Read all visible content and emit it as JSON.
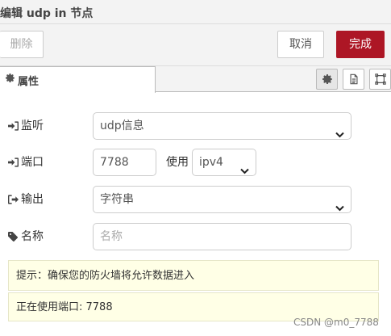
{
  "window": {
    "title": "编辑 udp in 节点"
  },
  "buttons": {
    "delete": "删除",
    "cancel": "取消",
    "done": "完成"
  },
  "tabs": [
    {
      "label": "属性",
      "icon": "gear-icon",
      "active": true
    }
  ],
  "tab_tools": [
    {
      "icon": "gear-icon",
      "active": true
    },
    {
      "icon": "document-icon",
      "active": false
    },
    {
      "icon": "frame-icon",
      "active": false
    }
  ],
  "form": {
    "listen": {
      "label": "监听",
      "value": "udp信息",
      "icon": "sign-in-icon"
    },
    "port": {
      "label": "端口",
      "value": "7788",
      "icon": "sign-in-icon"
    },
    "use": {
      "label": "使用",
      "value": "ipv4"
    },
    "output": {
      "label": "输出",
      "value": "字符串",
      "icon": "sign-out-icon"
    },
    "name": {
      "label": "名称",
      "placeholder": "名称",
      "value": "",
      "icon": "tag-icon"
    }
  },
  "tips": {
    "firewall": "提示：确保您的防火墙将允许数据进入",
    "port_in_use": "正在使用端口: 7788"
  },
  "watermark": "CSDN @m0_7788",
  "colors": {
    "primary": "#ad1625",
    "tip_bg": "#ffffe6",
    "bar_bg": "#f3f3f3"
  }
}
